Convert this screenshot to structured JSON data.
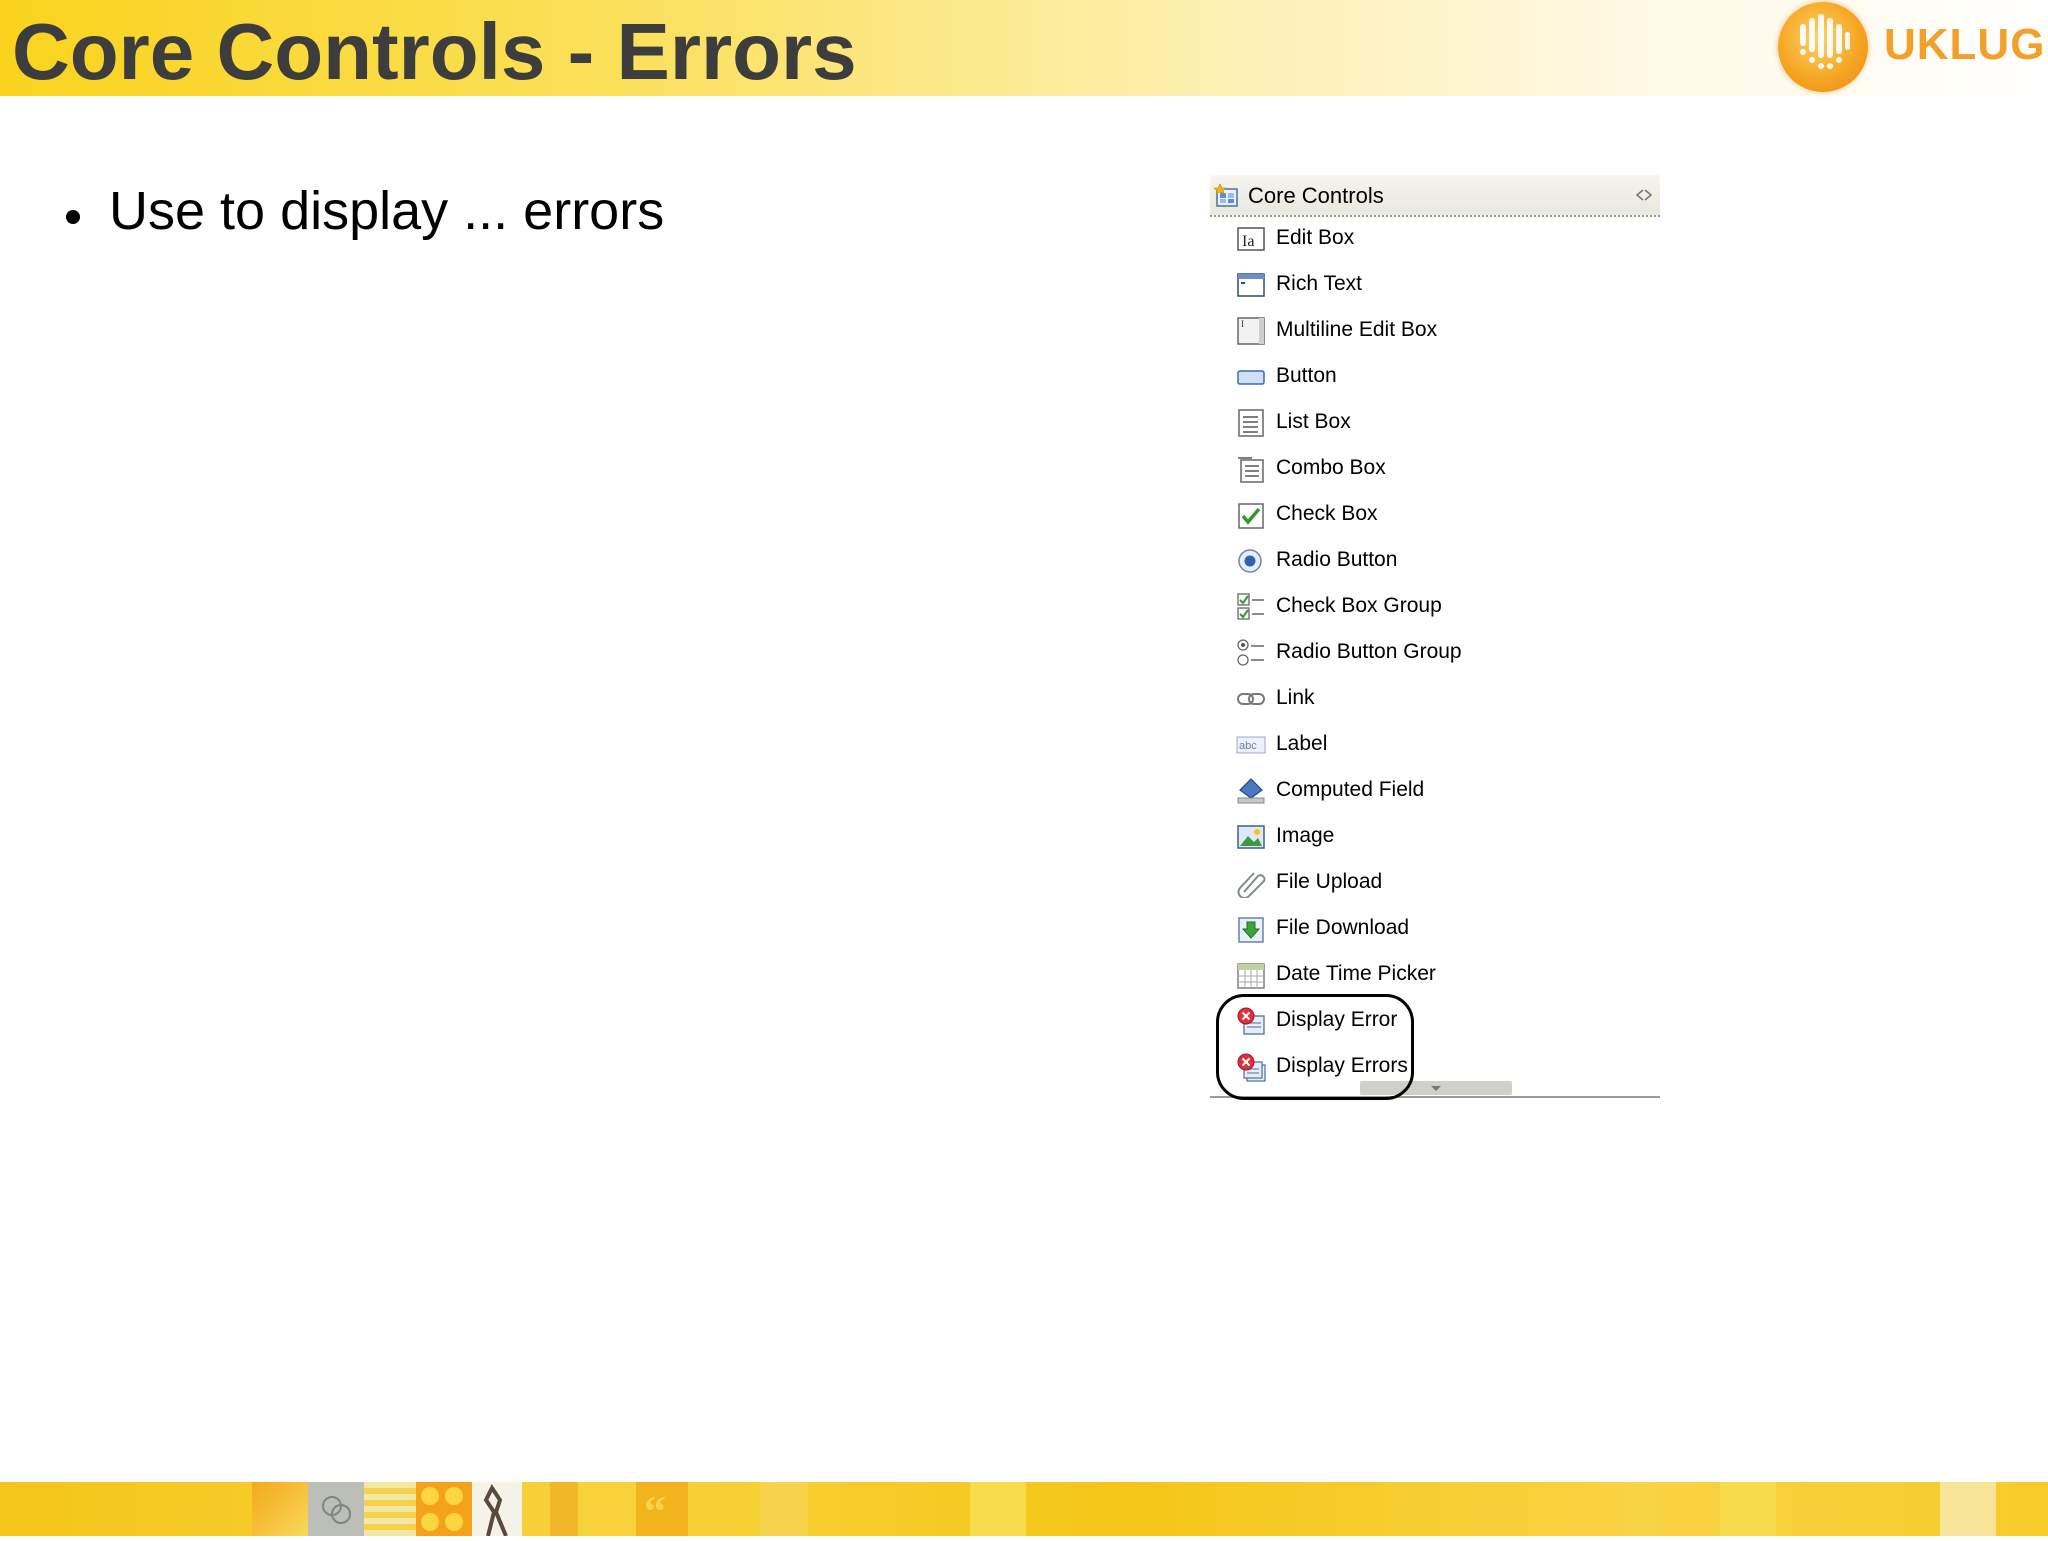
{
  "slide": {
    "title": "Core Controls - Errors",
    "bullet": "Use to display ... errors"
  },
  "logo": {
    "text": "UKLUG"
  },
  "palette": {
    "header": "Core Controls",
    "items": [
      {
        "label": "Edit Box",
        "icon": "edit-box-icon"
      },
      {
        "label": "Rich Text",
        "icon": "rich-text-icon"
      },
      {
        "label": "Multiline Edit Box",
        "icon": "multiline-edit-box-icon"
      },
      {
        "label": "Button",
        "icon": "button-icon"
      },
      {
        "label": "List Box",
        "icon": "list-box-icon"
      },
      {
        "label": "Combo Box",
        "icon": "combo-box-icon"
      },
      {
        "label": "Check Box",
        "icon": "check-box-icon"
      },
      {
        "label": "Radio Button",
        "icon": "radio-button-icon"
      },
      {
        "label": "Check Box Group",
        "icon": "check-box-group-icon"
      },
      {
        "label": "Radio Button Group",
        "icon": "radio-button-group-icon"
      },
      {
        "label": "Link",
        "icon": "link-icon"
      },
      {
        "label": "Label",
        "icon": "label-icon"
      },
      {
        "label": "Computed Field",
        "icon": "computed-field-icon"
      },
      {
        "label": "Image",
        "icon": "image-icon"
      },
      {
        "label": "File Upload",
        "icon": "file-upload-icon"
      },
      {
        "label": "File Download",
        "icon": "file-download-icon"
      },
      {
        "label": "Date Time Picker",
        "icon": "date-time-picker-icon"
      },
      {
        "label": "Display Error",
        "icon": "display-error-icon"
      },
      {
        "label": "Display Errors",
        "icon": "display-errors-icon"
      }
    ]
  },
  "colors": {
    "title": "#3d3d3d",
    "header_yellow": "#f9d31d",
    "logo_orange": "#f2a02a",
    "footer_yellow": "#f5c61a",
    "error_red": "#e0303a"
  }
}
